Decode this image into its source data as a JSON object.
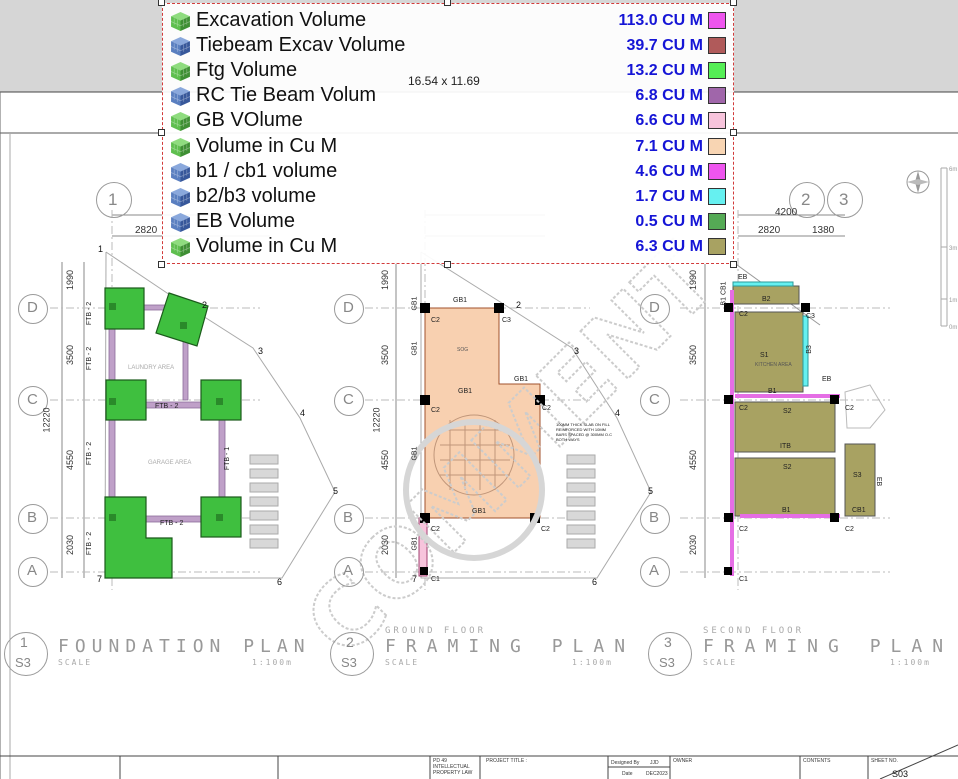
{
  "legend": [
    {
      "name": "Excavation Volume",
      "value": "113.0 CU M",
      "color": "#ee55ee",
      "cube": "green"
    },
    {
      "name": "Tiebeam Excav Volume",
      "value": "39.7 CU M",
      "color": "#b05a5a",
      "cube": "blue"
    },
    {
      "name": "Ftg Volume",
      "value": "13.2 CU M",
      "color": "#55ee55",
      "cube": "green"
    },
    {
      "name": "RC Tie Beam Volum",
      "value": "6.8 CU M",
      "color": "#a066aa",
      "cube": "blue"
    },
    {
      "name": "GB VOlume",
      "value": "6.6 CU M",
      "color": "#f7c4dc",
      "cube": "green"
    },
    {
      "name": "Volume in  Cu M",
      "value": "7.1 CU M",
      "color": "#f8d5b3",
      "cube": "green"
    },
    {
      "name": "b1 / cb1 volume",
      "value": "4.6 CU M",
      "color": "#ee55ee",
      "cube": "blue"
    },
    {
      "name": "b2/b3 volume",
      "value": "1.7 CU M",
      "color": "#66f0f0",
      "cube": "blue"
    },
    {
      "name": "EB Volume",
      "value": "0.5 CU M",
      "color": "#55aa55",
      "cube": "blue"
    },
    {
      "name": "Volume in  Cu M",
      "value": "6.3 CU M",
      "color": "#a8a262",
      "cube": "green"
    }
  ],
  "paper_size": "16.54 x 11.69",
  "grid": {
    "cols": [
      "1",
      "2",
      "3"
    ],
    "rows": [
      "D",
      "C",
      "B",
      "A"
    ],
    "dims_top": [
      "4200",
      "2820",
      "1380"
    ],
    "dims_left": [
      "1990",
      "3500",
      "12220",
      "4550",
      "2030"
    ],
    "dim_pair": [
      "1990",
      "3500",
      "4550",
      "2030"
    ]
  },
  "plans": [
    {
      "num": "1",
      "sheet": "S3",
      "title": "FOUNDATION PLAN",
      "subtitle": "",
      "scale": "SCALE",
      "ratio": "1:100m"
    },
    {
      "num": "2",
      "sheet": "S3",
      "title": "FRAMING PLAN",
      "subtitle": "GROUND FLOOR",
      "scale": "SCALE",
      "ratio": "1:100m"
    },
    {
      "num": "3",
      "sheet": "S3",
      "title": "FRAMING PLAN",
      "subtitle": "SECOND FLOOR",
      "scale": "SCALE",
      "ratio": "1:100m"
    }
  ],
  "labels": {
    "ftb2": "FTB - 2",
    "ftb1": "FTB - 1",
    "gb1": "GB1",
    "b1": "B1",
    "b2": "B2",
    "b3": "B3",
    "c1": "C1",
    "c2": "C2",
    "c3": "C3",
    "eb": "EB",
    "cb1": "CB1",
    "s1": "S1",
    "s2": "S2",
    "s3": "S3",
    "itb": "ITB",
    "cb1b1": "B1 CB1",
    "laundry": "LAUNDRY AREA",
    "garage": "GARAGE AREA",
    "kitchen": "KITCHEN AREA",
    "pts": [
      "1",
      "2",
      "3",
      "4",
      "5",
      "6",
      "7"
    ],
    "slab_note": "100MM THICK SLAB ON FILL REINFORCED WITH 10MM BARS SPACED @ 300MM O.C BOTH WAYS",
    "sog": "SOG"
  },
  "title_block": {
    "law": "PD 49 INTELLECTUAL PROPERTY LAW",
    "project": "PROJECT TITLE :",
    "designed": "Designed By",
    "designed_val": "JJD",
    "date": "Date",
    "date_val": "DEC2023",
    "owner": "OWNER",
    "contents": "CONTENTS",
    "sheet": "SHEET NO.",
    "sheet_val": "S03"
  },
  "scale_bar": [
    "6m",
    "3m",
    "1m",
    "0m"
  ],
  "watermark": "COMMENT"
}
